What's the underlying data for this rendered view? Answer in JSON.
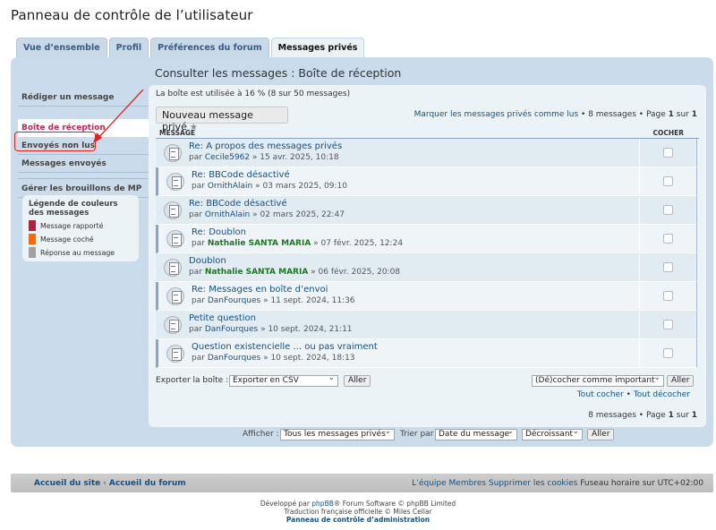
{
  "page_title": "Panneau de contrôle de l’utilisateur",
  "tabs": [
    {
      "label": "Vue d’ensemble"
    },
    {
      "label": "Profil"
    },
    {
      "label": "Préférences du forum"
    },
    {
      "label": "Messages privés"
    }
  ],
  "sidebar": {
    "items": [
      {
        "label": "Rédiger un message"
      },
      {
        "label": "Boîte de réception"
      },
      {
        "label": "Envoyés non lus"
      },
      {
        "label": "Messages envoyés"
      },
      {
        "label": "Gérer les brouillons de MP"
      }
    ]
  },
  "legend": {
    "title": "Légende de couleurs des messages",
    "items": [
      {
        "label": "Message rapporté",
        "color": "#b0233f"
      },
      {
        "label": "Message coché",
        "color": "#ff6600"
      },
      {
        "label": "Réponse au message",
        "color": "#a1a1a1"
      }
    ]
  },
  "content": {
    "heading": "Consulter les messages : Boîte de réception",
    "usage": "La boîte est utilisée à 16 % (8 sur 50 messages)",
    "new_button": "Nouveau message privé",
    "mark_read": "Marquer les messages privés comme lus",
    "pager": "• 8 messages • Page",
    "page_current": "1",
    "page_of": "sur",
    "page_total": "1",
    "col_message": "MESSAGE",
    "col_check": "COCHER",
    "by": "par",
    "messages": [
      {
        "subject": "Re: A propos des messages privés",
        "author": "Cecile5962",
        "date": "» 15 avr. 2025, 10:18",
        "green": false
      },
      {
        "subject": "Re: BBCode désactivé",
        "author": "OrnithAlain",
        "date": "» 03 mars 2025, 09:10",
        "green": false
      },
      {
        "subject": "Re: BBCode désactivé",
        "author": "OrnithAlain",
        "date": "» 02 mars 2025, 22:47",
        "green": false
      },
      {
        "subject": "Re: Doublon",
        "author": "Nathalie SANTA MARIA",
        "date": "» 07 févr. 2025, 12:24",
        "green": true
      },
      {
        "subject": "Doublon",
        "author": "Nathalie SANTA MARIA",
        "date": "» 06 févr. 2025, 20:08",
        "green": true
      },
      {
        "subject": "Re: Messages en boîte d’envoi",
        "author": "DanFourques",
        "date": "» 11 sept. 2024, 11:36",
        "green": false
      },
      {
        "subject": "Petite question",
        "author": "DanFourques",
        "date": "» 10 sept. 2024, 21:11",
        "green": false
      },
      {
        "subject": "Question existencielle ... ou pas vraiment",
        "author": "DanFourques",
        "date": "» 10 sept. 2024, 18:13",
        "green": false
      }
    ],
    "export_label": "Exporter la boîte :",
    "export_select": "Exporter en CSV",
    "go": "Aller",
    "mark_select": "(Dé)cocher comme important",
    "check_all": "Tout cocher",
    "bullet": "•",
    "uncheck_all": "Tout décocher",
    "pager_bottom": "8 messages • Page"
  },
  "filters": {
    "show_label": "Afficher :",
    "show_value": "Tous les messages privés",
    "sort_label": "Trier par",
    "sort_value": "Date du message",
    "order_value": "Décroissant",
    "go": "Aller"
  },
  "footer": {
    "home": "Accueil du site",
    "forum": "Accueil du forum",
    "team": "L’équipe",
    "members": "Membres",
    "cookies": "Supprimer les cookies",
    "timezone": "Fuseau horaire sur UTC+02:00",
    "credit_prefix": "Développé par",
    "credit_phpbb": "phpBB",
    "credit_suffix": "® Forum Software © phpBB Limited",
    "credit_translation": "Traduction française officielle © Miles Cellar",
    "acp_link": "Panneau de contrôle d’administration"
  },
  "annotation": {
    "color": "#e52020"
  }
}
